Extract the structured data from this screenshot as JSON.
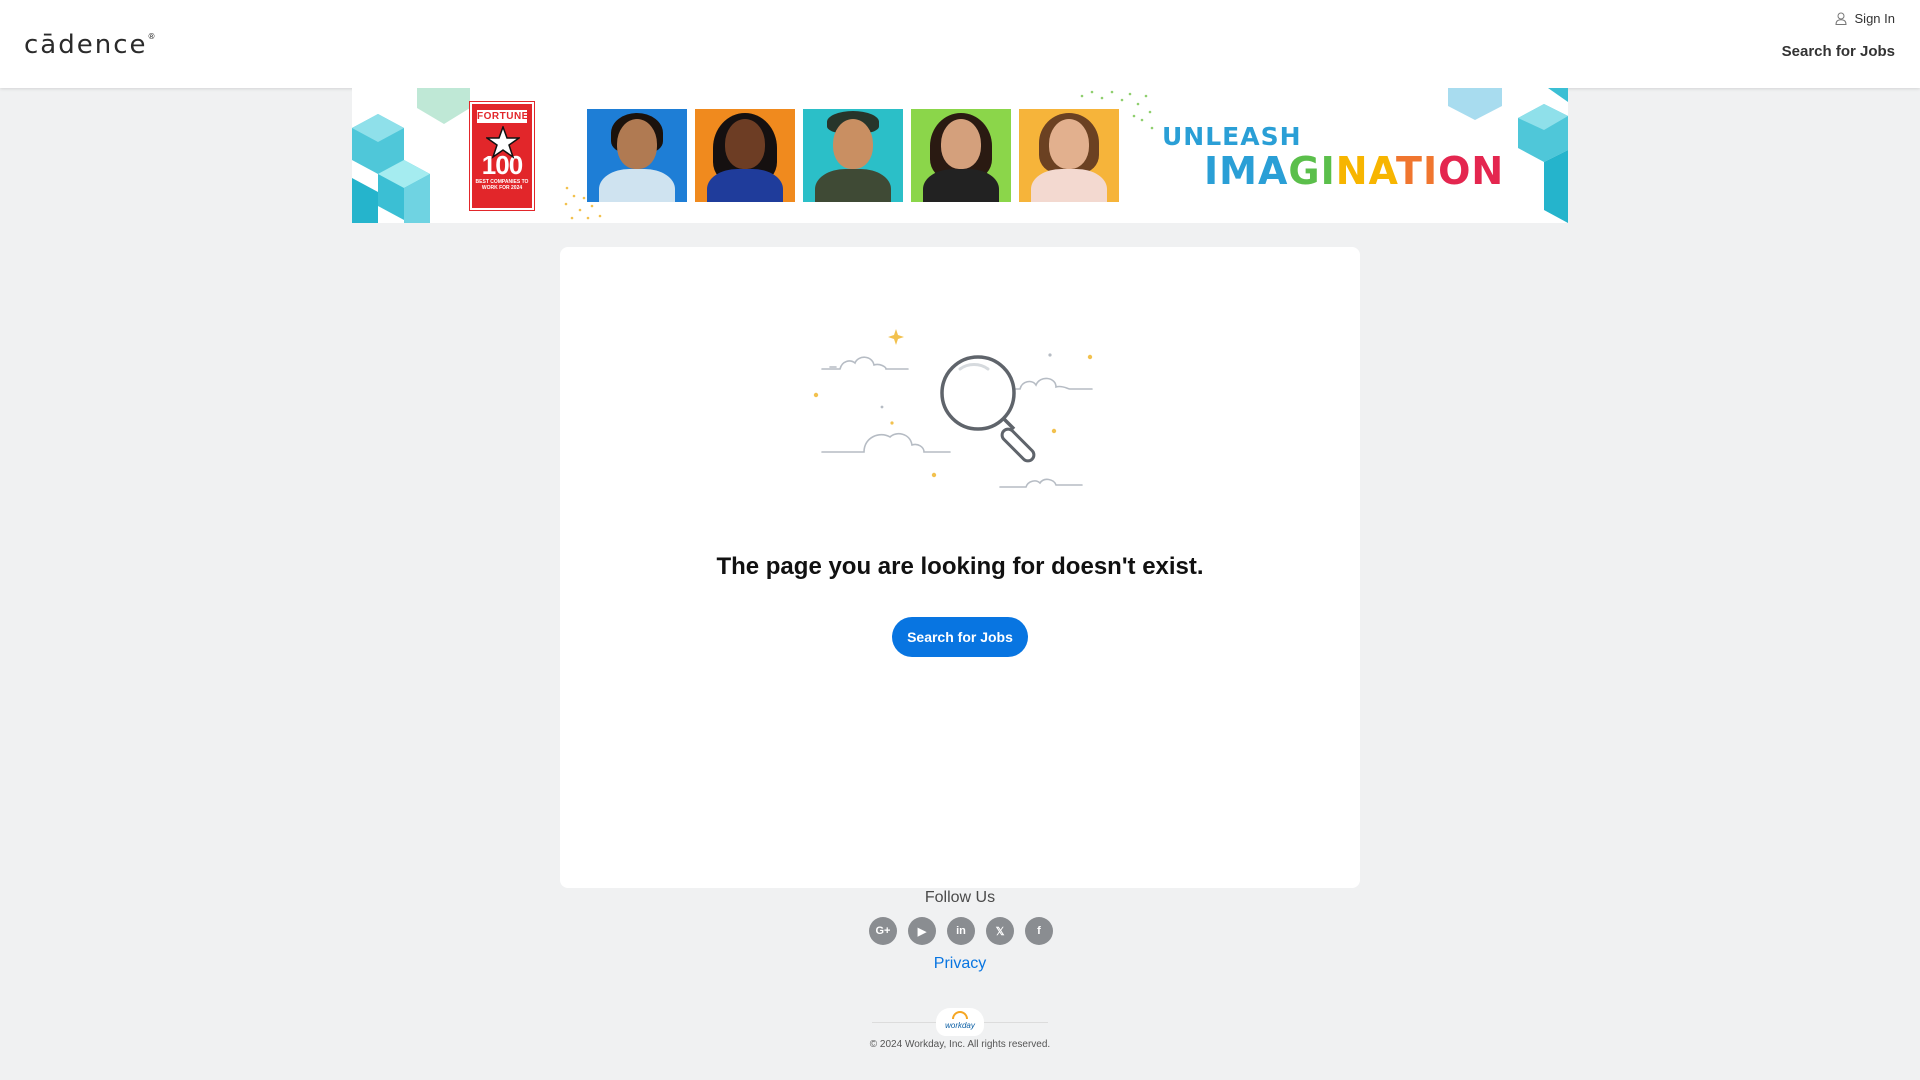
{
  "header": {
    "logo": "cādence",
    "sign_in": "Sign In",
    "search_jobs": "Search for Jobs"
  },
  "banner": {
    "fortune_title": "FORTUNE",
    "fortune_number": "100",
    "fortune_subtitle": "BEST COMPANIES TO WORK FOR 2024",
    "headline_line1": "UNLEASH",
    "headline_line2": "IMAGINATION",
    "colors": [
      "#2a9fd6",
      "#5bbf4b",
      "#f7b500",
      "#f0762f",
      "#e4264f"
    ]
  },
  "main": {
    "message": "The page you are looking for doesn't exist.",
    "button_label": "Search for Jobs"
  },
  "footer": {
    "follow_label": "Follow Us",
    "socials": [
      {
        "icon": "google-plus-icon",
        "glyph": "G+"
      },
      {
        "icon": "youtube-icon",
        "glyph": "▶"
      },
      {
        "icon": "linkedin-icon",
        "glyph": "in"
      },
      {
        "icon": "x-icon",
        "glyph": "𝕏"
      },
      {
        "icon": "facebook-icon",
        "glyph": "f"
      }
    ],
    "privacy": "Privacy",
    "workday_logo": "workday",
    "copyright": "© 2024 Workday, Inc. All rights reserved."
  },
  "theme": {
    "accent": "#0875e1",
    "background": "#f0f1f2"
  }
}
